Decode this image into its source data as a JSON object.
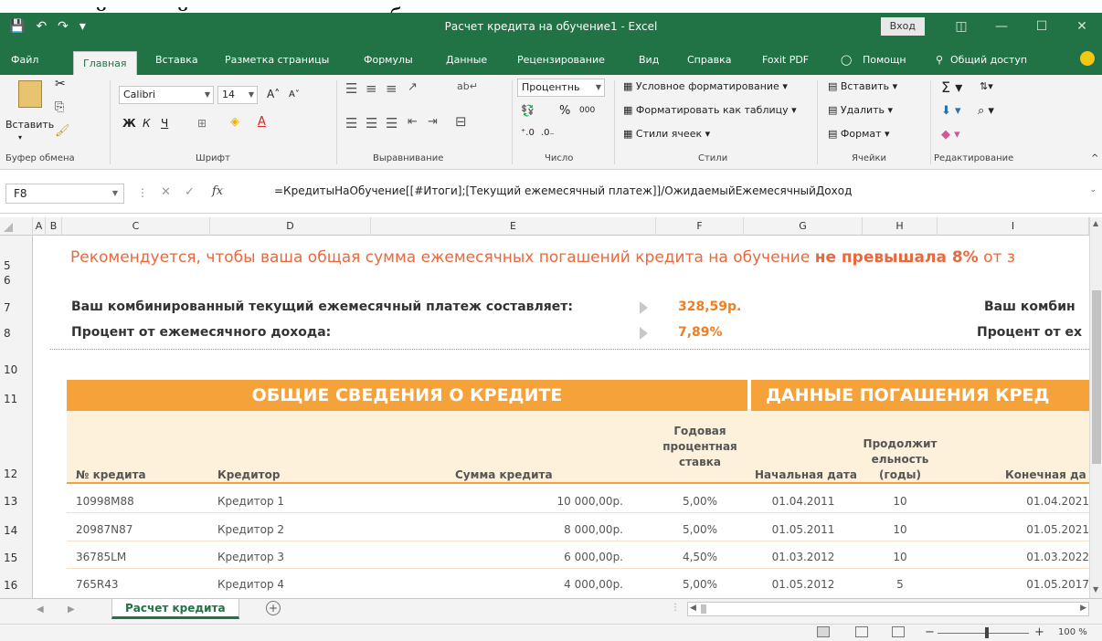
{
  "document_text": "дарностей данной программы при работе с документами.",
  "window": {
    "title": "Расчет кредита на обучение1  -  Excel",
    "signin_label": "Вход",
    "minimize": "—",
    "maximize": "☐",
    "close": "✕"
  },
  "tabs": [
    {
      "label": "Файл"
    },
    {
      "label": "Главная"
    },
    {
      "label": "Вставка"
    },
    {
      "label": "Разметка страницы"
    },
    {
      "label": "Формулы"
    },
    {
      "label": "Данные"
    },
    {
      "label": "Рецензирование"
    },
    {
      "label": "Вид"
    },
    {
      "label": "Справка"
    },
    {
      "label": "Foxit PDF"
    },
    {
      "label": "Помощн"
    },
    {
      "label": "Общий доступ"
    }
  ],
  "ribbon": {
    "clipboard": {
      "label": "Буфер обмена",
      "paste": "Вставить"
    },
    "font": {
      "label": "Шрифт",
      "name": "Calibri",
      "size": "14",
      "bold": "Ж",
      "italic": "К",
      "underline": "Ч"
    },
    "alignment": {
      "label": "Выравнивание"
    },
    "number": {
      "label": "Число",
      "format": "Процентнь",
      "percent": "%",
      "thousands": "000"
    },
    "styles": {
      "label": "Стили",
      "conditional": "Условное форматирование",
      "as_table": "Форматировать как таблицу",
      "cell_styles": "Стили ячеек"
    },
    "cells": {
      "label": "Ячейки",
      "insert": "Вставить",
      "delete": "Удалить",
      "format": "Формат"
    },
    "editing": {
      "label": "Редактирование"
    }
  },
  "formula_bar": {
    "name_box": "F8",
    "fx": "fx",
    "formula": "=КредитыНаОбучение[[#Итоги];[Текущий ежемесячный платеж]]/ОжидаемыйЕжемесячныйДоход"
  },
  "columns": [
    "A",
    "B",
    "C",
    "D",
    "E",
    "F",
    "G",
    "H",
    "I"
  ],
  "rows": [
    "5",
    "6",
    "7",
    "8",
    "10",
    "11",
    "12",
    "13",
    "14",
    "15",
    "16"
  ],
  "sheet": {
    "recommend_text": "Рекомендуется, чтобы ваша общая сумма ежемесячных погашений кредита на обучение ",
    "recommend_bold": "не превышала 8%",
    "recommend_tail": " от з",
    "payment_label": "Ваш комбинированный текущий ежемесячный платеж составляет:",
    "payment_value": "328,59р.",
    "percent_label": "Процент от ежемесячного дохода:",
    "percent_value": "7,89%",
    "right_payment_label": "Ваш комбин",
    "right_percent_label": "Процент от ех",
    "band_left": "ОБЩИЕ СВЕДЕНИЯ О КРЕДИТЕ",
    "band_right": "ДАННЫЕ ПОГАШЕНИЯ КРЕД",
    "headers": {
      "loan_no": "№ кредита",
      "lender": "Кредитор",
      "amount": "Сумма кредита",
      "rate_1": "Годовая",
      "rate_2": "процентная",
      "rate_3": "ставка",
      "start": "Начальная дата",
      "dur_1": "Продолжит",
      "dur_2": "ельность",
      "dur_3": "(годы)",
      "end": "Конечная да"
    },
    "loans": [
      {
        "no": "10998M88",
        "lender": "Кредитор 1",
        "amount": "10 000,00р.",
        "rate": "5,00%",
        "start": "01.04.2011",
        "years": "10",
        "end": "01.04.2021"
      },
      {
        "no": "20987N87",
        "lender": "Кредитор 2",
        "amount": "8 000,00р.",
        "rate": "5,00%",
        "start": "01.05.2011",
        "years": "10",
        "end": "01.05.2021"
      },
      {
        "no": "36785LM",
        "lender": "Кредитор 3",
        "amount": "6 000,00р.",
        "rate": "4,50%",
        "start": "01.03.2012",
        "years": "10",
        "end": "01.03.2022"
      },
      {
        "no": "765R43",
        "lender": "Кредитор 4",
        "amount": "4 000,00р.",
        "rate": "5,00%",
        "start": "01.05.2012",
        "years": "5",
        "end": "01.05.2017"
      }
    ]
  },
  "sheet_tabs": [
    {
      "label": "Расчет кредита"
    }
  ],
  "status": {
    "zoom": "100 %"
  }
}
